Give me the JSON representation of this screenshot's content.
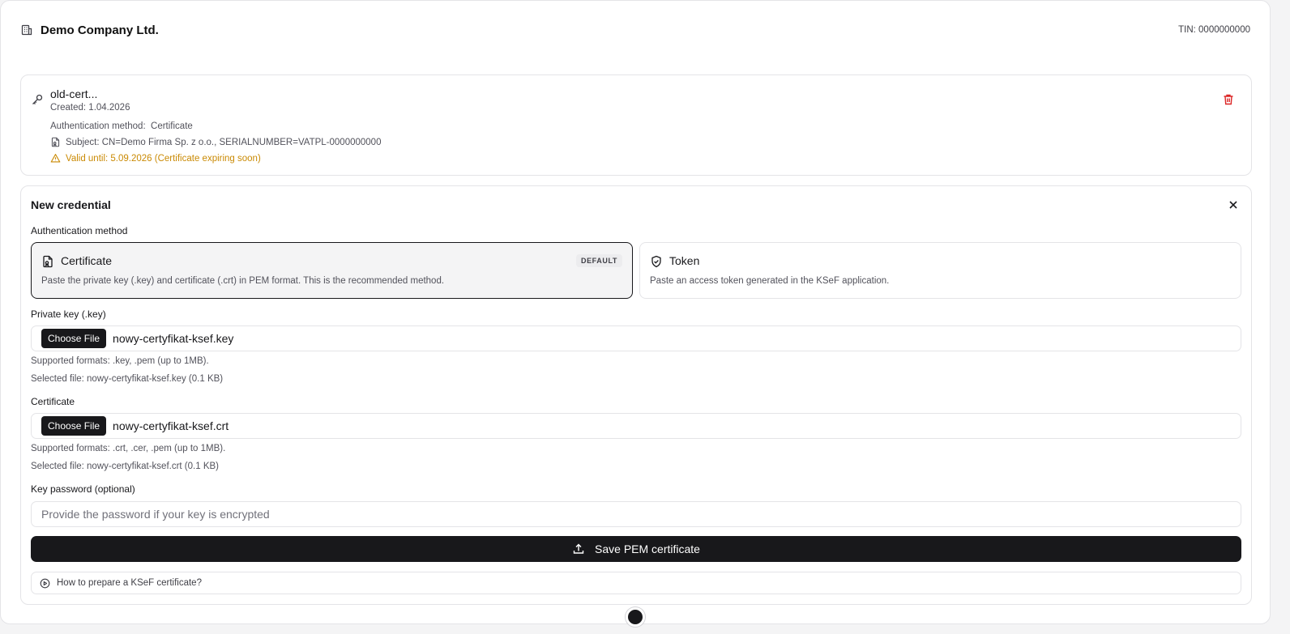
{
  "header": {
    "company_name": "Demo Company Ltd.",
    "tin": "TIN: 0000000000"
  },
  "existing_credential": {
    "name": "old-cert...",
    "created": "Created: 1.04.2026",
    "method_label": "Authentication method:",
    "method_value": "Certificate",
    "subject": "Subject: CN=Demo Firma Sp. z o.o., SERIALNUMBER=VATPL-0000000000",
    "valid_until": "Valid until: 5.09.2026 (Certificate expiring soon)"
  },
  "new_credential": {
    "title": "New credential",
    "auth_method_label": "Authentication method",
    "options": [
      {
        "title": "Certificate",
        "badge": "DEFAULT",
        "description": "Paste the private key (.key) and certificate (.crt) in PEM format. This is the recommended method.",
        "selected": true
      },
      {
        "title": "Token",
        "description": "Paste an access token generated in the KSeF application.",
        "selected": false
      }
    ],
    "private_key": {
      "label": "Private key (.key)",
      "button": "Choose File",
      "filename": "nowy-certyfikat-ksef.key",
      "supported": "Supported formats: .key, .pem (up to 1MB).",
      "selected": "Selected file: nowy-certyfikat-ksef.key (0.1 KB)"
    },
    "certificate": {
      "label": "Certificate",
      "button": "Choose File",
      "filename": "nowy-certyfikat-ksef.crt",
      "supported": "Supported formats: .crt, .cer, .pem (up to 1MB).",
      "selected": "Selected file: nowy-certyfikat-ksef.crt (0.1 KB)"
    },
    "password": {
      "label": "Key password (optional)",
      "placeholder": "Provide the password if your key is encrypted",
      "value": ""
    },
    "save_button": "Save PEM certificate",
    "howto_link": "How to prepare a KSeF certificate?"
  },
  "colors": {
    "primary": "#18181b",
    "warning": "#ca8a04",
    "danger": "#dc2626",
    "border": "#e4e4e7"
  }
}
